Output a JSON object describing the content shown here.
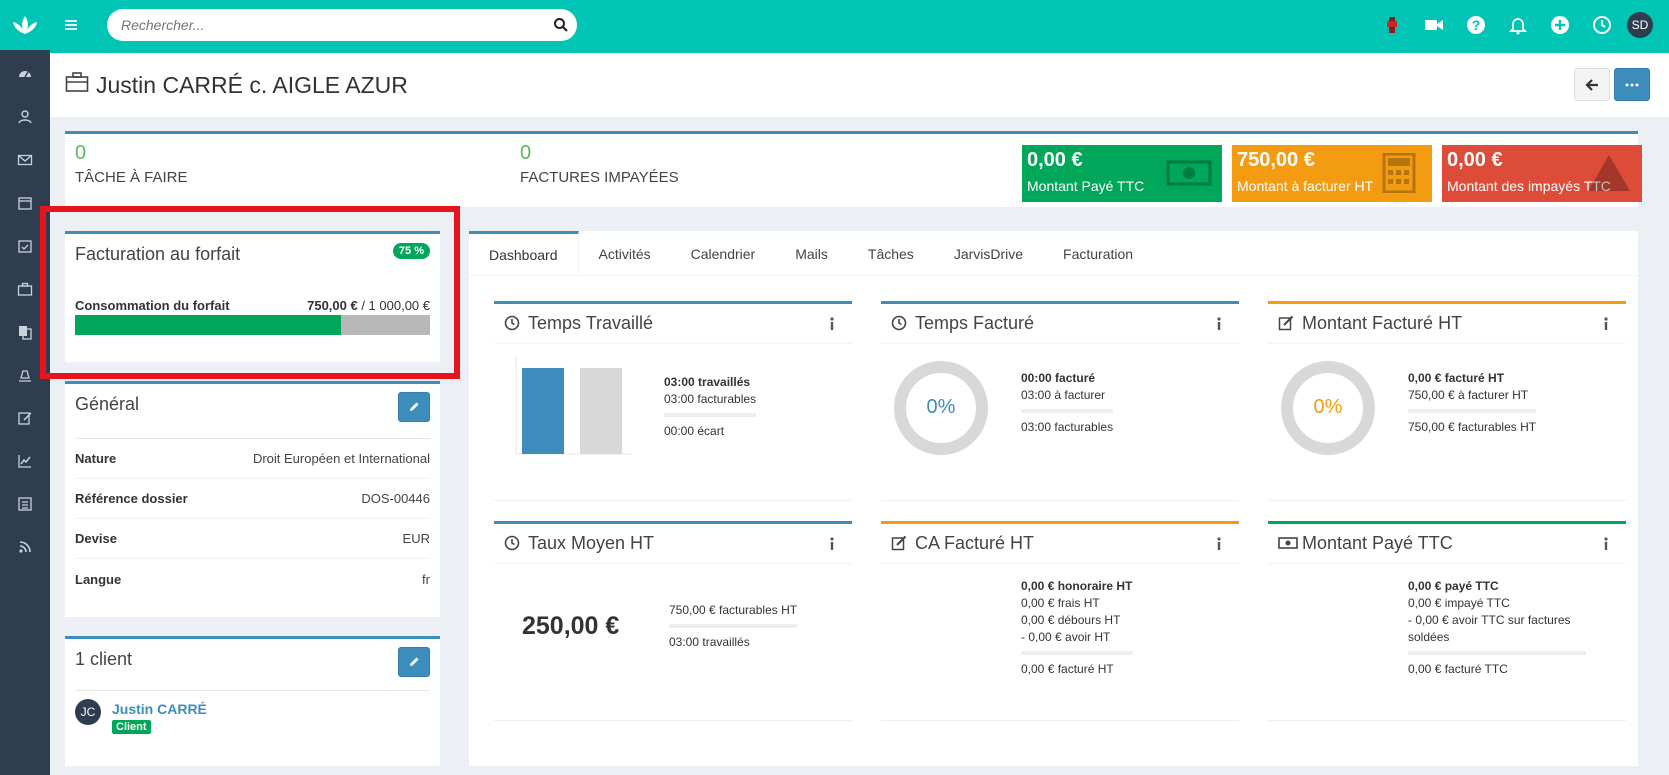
{
  "search": {
    "placeholder": "Rechercher..."
  },
  "header": {
    "title": "Justin CARRÉ c. AIGLE AZUR"
  },
  "user": {
    "initials": "SD"
  },
  "summary": {
    "stats": [
      {
        "value": "0",
        "label": "TÂCHE À FAIRE"
      },
      {
        "value": "0",
        "label": "FACTURES IMPAYÉES"
      }
    ],
    "kpis": [
      {
        "value": "0,00 €",
        "label": "Montant Payé TTC",
        "color": "#00a65a",
        "icon": "banknote-icon"
      },
      {
        "value": "750,00 €",
        "label": "Montant à facturer HT",
        "color": "#f39c12",
        "icon": "calculator-icon"
      },
      {
        "value": "0,00 €",
        "label": "Montant des impayés TTC",
        "color": "#dd4b39",
        "icon": "warning-icon"
      }
    ]
  },
  "forfait": {
    "title": "Facturation au forfait",
    "badge": "75 %",
    "progress_fraction": 0.75,
    "label": "Consommation du forfait",
    "consumed": "750,00 €",
    "total": " / 1 000,00 €"
  },
  "general": {
    "title": "Général",
    "rows": [
      {
        "key": "Nature",
        "value": "Droit Européen et International"
      },
      {
        "key": "Référence dossier",
        "value": "DOS-00446"
      },
      {
        "key": "Devise",
        "value": "EUR"
      },
      {
        "key": "Langue",
        "value": "fr"
      }
    ]
  },
  "clients": {
    "title": "1 client",
    "items": [
      {
        "initials": "JC",
        "name": "Justin CARRÉ",
        "tag": "Client"
      }
    ]
  },
  "tabs": [
    "Dashboard",
    "Activités",
    "Calendrier",
    "Mails",
    "Tâches",
    "JarvisDrive",
    "Facturation"
  ],
  "cards": {
    "temps_travaille": {
      "title": "Temps Travaillé",
      "bars": {
        "travaille_h": 3,
        "facturable_h": 3
      },
      "line1": "03:00 travaillés",
      "line2": "03:00 facturables",
      "line3": "00:00 écart"
    },
    "temps_facture": {
      "title": "Temps Facturé",
      "percent": "0%",
      "line1": "00:00 facturé",
      "line2": "03:00 à facturer",
      "line3": "03:00 facturables"
    },
    "montant_facture": {
      "title": "Montant Facturé HT",
      "percent": "0%",
      "line1": "0,00 € facturé HT",
      "line2": "750,00 € à facturer HT",
      "line3": "750,00 € facturables HT"
    },
    "taux_moyen": {
      "title": "Taux Moyen HT",
      "value": "250,00 €",
      "line1": "750,00 € facturables HT",
      "line2": "03:00 travaillés"
    },
    "ca_facture": {
      "title": "CA Facturé HT",
      "line1": "0,00 € honoraire HT",
      "line2": "0,00 € frais HT",
      "line3": "0,00 € débours HT",
      "line4": "- 0,00 € avoir HT",
      "line5": "0,00 € facturé HT"
    },
    "montant_paye": {
      "title": "Montant Payé TTC",
      "line1": "0,00 € payé TTC",
      "line2": "0,00 € impayé TTC",
      "line3": "- 0,00 € avoir TTC sur factures soldées",
      "line4": "0,00 € facturé TTC"
    }
  },
  "colors": {
    "teal": "#00c4b4",
    "rail": "#2e3e50",
    "blue": "#3c8dbc",
    "green": "#00a65a",
    "orange": "#f39c12",
    "red": "#dd4b39",
    "highlight": "#e8141d"
  }
}
